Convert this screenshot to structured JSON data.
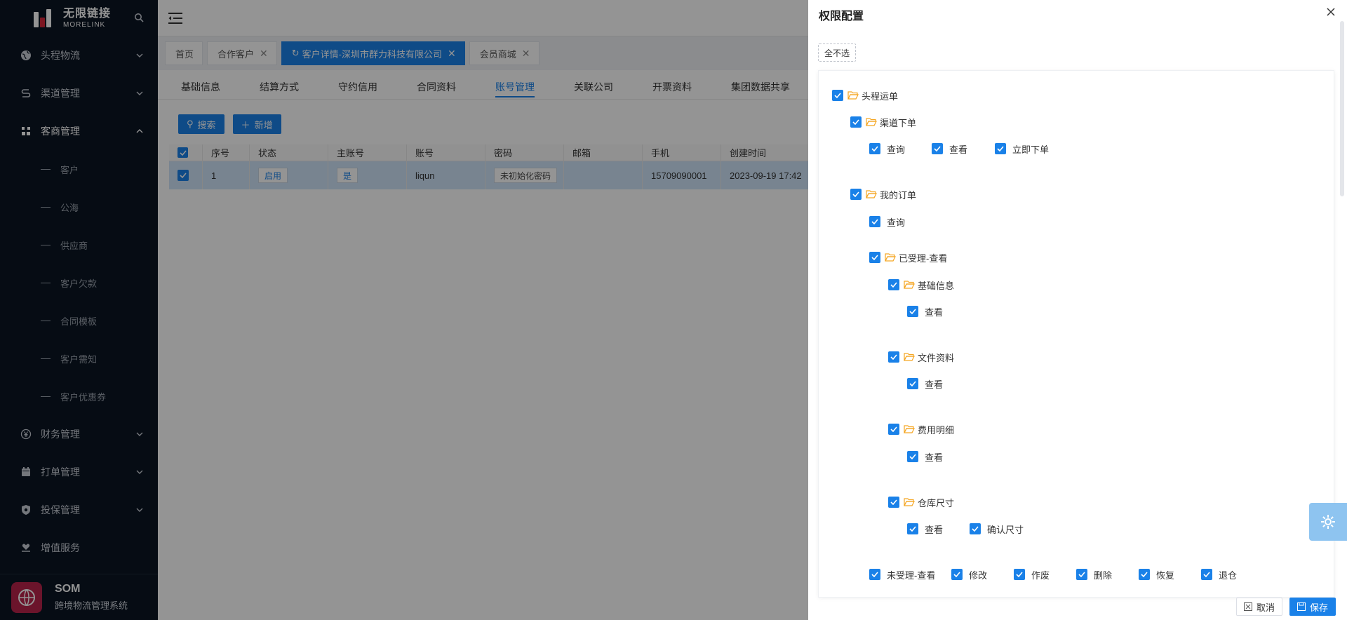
{
  "sidebar": {
    "logo_cn": "无限链接",
    "logo_en": "MORELINK",
    "items": [
      {
        "label": "头程物流"
      },
      {
        "label": "渠道管理"
      },
      {
        "label": "客商管理"
      },
      {
        "label": "财务管理"
      },
      {
        "label": "打单管理"
      },
      {
        "label": "投保管理"
      },
      {
        "label": "增值服务"
      }
    ],
    "sub_items": [
      "客户",
      "公海",
      "供应商",
      "客户欠款",
      "合同模板",
      "客户需知",
      "客户优惠券"
    ],
    "footer_title": "SOM",
    "footer_subtitle": "跨境物流管理系统"
  },
  "tags": [
    "首页",
    "合作客户",
    "客户详情-深圳市群力科技有限公司",
    "会员商城"
  ],
  "subtabs": [
    "基础信息",
    "结算方式",
    "守约信用",
    "合同资料",
    "账号管理",
    "关联公司",
    "开票资料",
    "集团数据共享"
  ],
  "toolbar": {
    "search": "搜索",
    "add": "新增"
  },
  "table": {
    "headers": [
      "序号",
      "状态",
      "主账号",
      "账号",
      "密码",
      "邮箱",
      "手机",
      "创建时间"
    ],
    "row": {
      "index": "1",
      "status": "启用",
      "main_account": "是",
      "account": "liqun",
      "password": "未初始化密码",
      "email": "",
      "phone": "15709090001",
      "created": "2023-09-19 17:42"
    }
  },
  "drawer": {
    "title": "权限配置",
    "select_none": "全不选",
    "cancel": "取消",
    "save": "保存",
    "tree": {
      "root": "头程运单",
      "channel_order": "渠道下单",
      "channel_query": "查询",
      "channel_view": "查看",
      "channel_order_now": "立即下单",
      "my_orders": "我的订单",
      "my_query": "查询",
      "accepted_view": "已受理-查看",
      "basic_info": "基础信息",
      "basic_view": "查看",
      "file_docs": "文件资料",
      "file_view": "查看",
      "fee_detail": "费用明细",
      "fee_view": "查看",
      "warehouse_size": "仓库尺寸",
      "wh_view": "查看",
      "wh_confirm": "确认尺寸",
      "unaccepted_view": "未受理-查看",
      "modify": "修改",
      "void": "作废",
      "delete": "删除",
      "restore": "恢复",
      "return_wh": "退仓"
    }
  },
  "colors": {
    "primary": "#1a81e8",
    "sidebar_bg": "#0b1524",
    "folder": "#f5a623"
  }
}
